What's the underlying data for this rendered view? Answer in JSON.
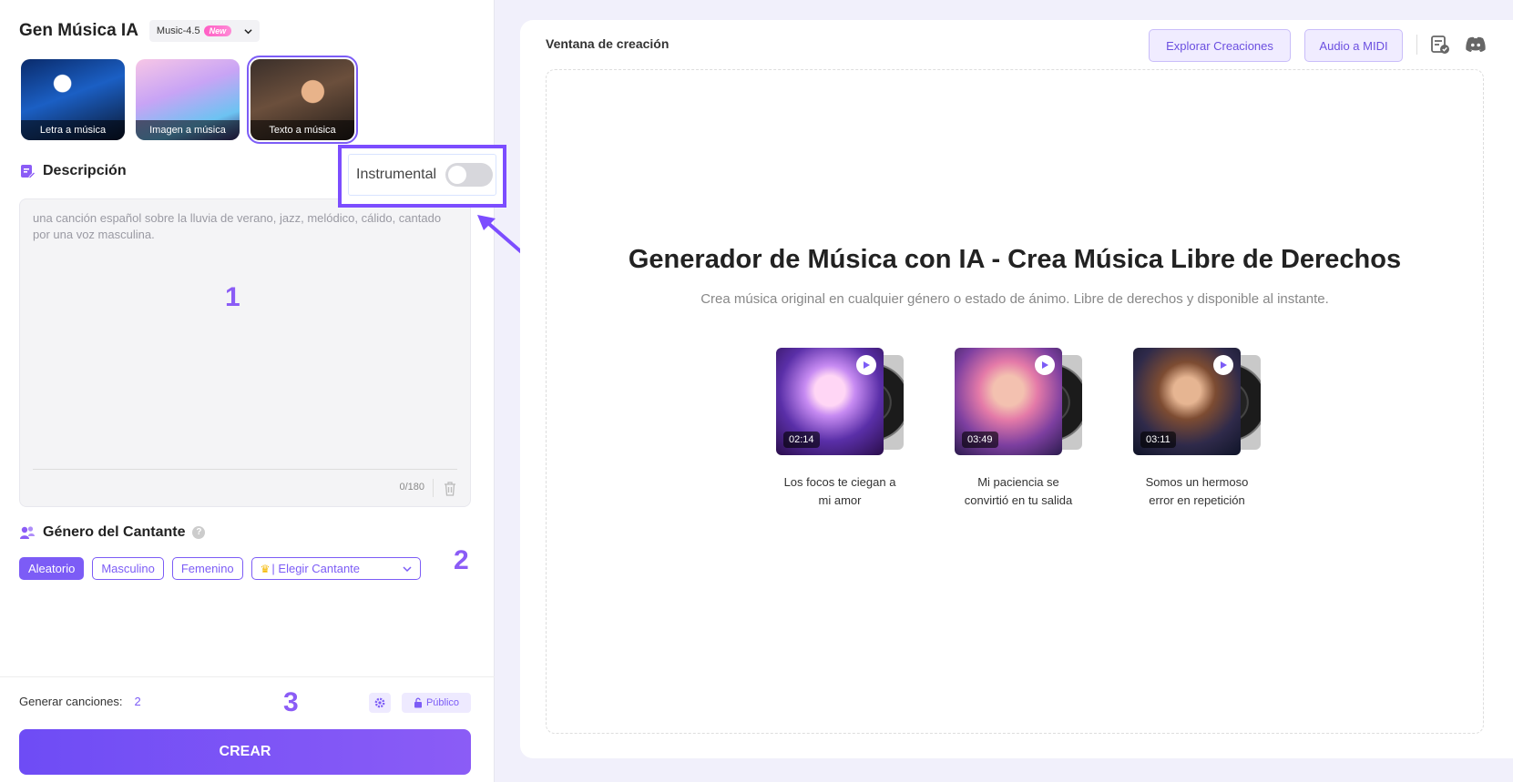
{
  "left": {
    "app_title": "Gen Música IA",
    "model": "Music-4.5",
    "model_badge": "New",
    "modes": [
      {
        "label": "Letra a música"
      },
      {
        "label": "Imagen a música"
      },
      {
        "label": "Texto a música",
        "selected": true
      }
    ],
    "description": {
      "title": "Descripción",
      "placeholder": "una canción español sobre la lluvia de verano, jazz, melódico, cálido, cantado por una voz masculina.",
      "counter": "0/180"
    },
    "instrumental": {
      "label": "Instrumental",
      "on": false
    },
    "singer_gender": {
      "title": "Género del Cantante",
      "options": [
        "Aleatorio",
        "Masculino",
        "Femenino"
      ],
      "selected": "Aleatorio",
      "choose_singer": "| Elegir Cantante"
    },
    "generate": {
      "label": "Generar canciones:",
      "count": "2"
    },
    "visibility": "Público",
    "create_button": "CREAR"
  },
  "annotations": {
    "n1": "1",
    "n2": "2",
    "n3": "3"
  },
  "right": {
    "window_title": "Ventana de creación",
    "buttons": {
      "explore": "Explorar Creaciones",
      "audio_midi": "Audio a MIDI"
    },
    "headline": "Generador de Música con IA - Crea Música Libre de Derechos",
    "subtitle": "Crea música original en cualquier género o estado de ánimo. Libre de derechos y disponible al instante.",
    "examples": [
      {
        "duration": "02:14",
        "title": "Los focos te ciegan a mi amor"
      },
      {
        "duration": "03:49",
        "title": "Mi paciencia se convirtió en tu salida"
      },
      {
        "duration": "03:11",
        "title": "Somos un hermoso error en repetición"
      }
    ]
  },
  "colors": {
    "accent": "#7c5cf6",
    "highlight_border": "#7c4dff",
    "page_bg": "#f1f0fb"
  }
}
